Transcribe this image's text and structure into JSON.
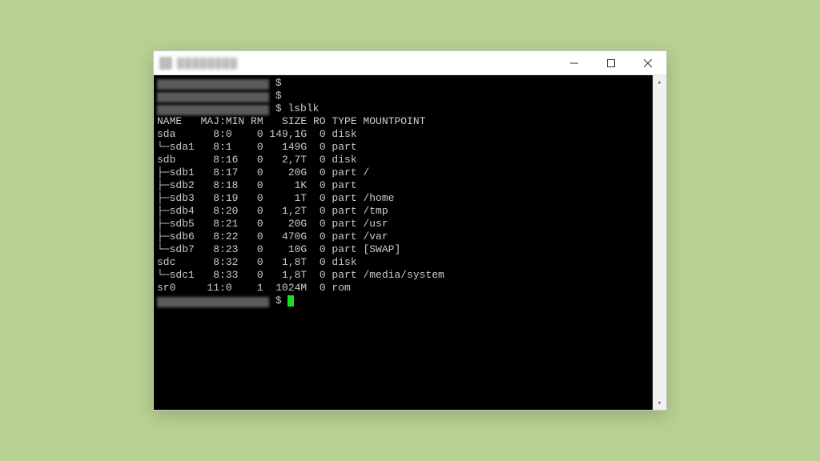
{
  "window": {
    "title": "████████"
  },
  "terminal": {
    "prompt_symbol": "$",
    "command": "lsblk",
    "header": "NAME   MAJ:MIN RM   SIZE RO TYPE MOUNTPOINT",
    "rows": [
      {
        "line": "sda      8:0    0 149,1G  0 disk "
      },
      {
        "line": "└─sda1   8:1    0   149G  0 part "
      },
      {
        "line": "sdb      8:16   0   2,7T  0 disk "
      },
      {
        "line": "├─sdb1   8:17   0    20G  0 part /"
      },
      {
        "line": "├─sdb2   8:18   0     1K  0 part "
      },
      {
        "line": "├─sdb3   8:19   0     1T  0 part /home"
      },
      {
        "line": "├─sdb4   8:20   0   1,2T  0 part /tmp"
      },
      {
        "line": "├─sdb5   8:21   0    20G  0 part /usr"
      },
      {
        "line": "├─sdb6   8:22   0   470G  0 part /var"
      },
      {
        "line": "└─sdb7   8:23   0    10G  0 part [SWAP]"
      },
      {
        "line": "sdc      8:32   0   1,8T  0 disk "
      },
      {
        "line": "└─sdc1   8:33   0   1,8T  0 part /media/system"
      },
      {
        "line": "sr0     11:0    1  1024M  0 rom  "
      }
    ]
  },
  "chart_data": {
    "type": "table",
    "title": "lsblk output",
    "columns": [
      "NAME",
      "MAJ:MIN",
      "RM",
      "SIZE",
      "RO",
      "TYPE",
      "MOUNTPOINT"
    ],
    "rows": [
      [
        "sda",
        "8:0",
        0,
        "149,1G",
        0,
        "disk",
        ""
      ],
      [
        "sda1",
        "8:1",
        0,
        "149G",
        0,
        "part",
        ""
      ],
      [
        "sdb",
        "8:16",
        0,
        "2,7T",
        0,
        "disk",
        ""
      ],
      [
        "sdb1",
        "8:17",
        0,
        "20G",
        0,
        "part",
        "/"
      ],
      [
        "sdb2",
        "8:18",
        0,
        "1K",
        0,
        "part",
        ""
      ],
      [
        "sdb3",
        "8:19",
        0,
        "1T",
        0,
        "part",
        "/home"
      ],
      [
        "sdb4",
        "8:20",
        0,
        "1,2T",
        0,
        "part",
        "/tmp"
      ],
      [
        "sdb5",
        "8:21",
        0,
        "20G",
        0,
        "part",
        "/usr"
      ],
      [
        "sdb6",
        "8:22",
        0,
        "470G",
        0,
        "part",
        "/var"
      ],
      [
        "sdb7",
        "8:23",
        0,
        "10G",
        0,
        "part",
        "[SWAP]"
      ],
      [
        "sdc",
        "8:32",
        0,
        "1,8T",
        0,
        "disk",
        ""
      ],
      [
        "sdc1",
        "8:33",
        0,
        "1,8T",
        0,
        "part",
        "/media/system"
      ],
      [
        "sr0",
        "11:0",
        1,
        "1024M",
        0,
        "rom",
        ""
      ]
    ]
  }
}
